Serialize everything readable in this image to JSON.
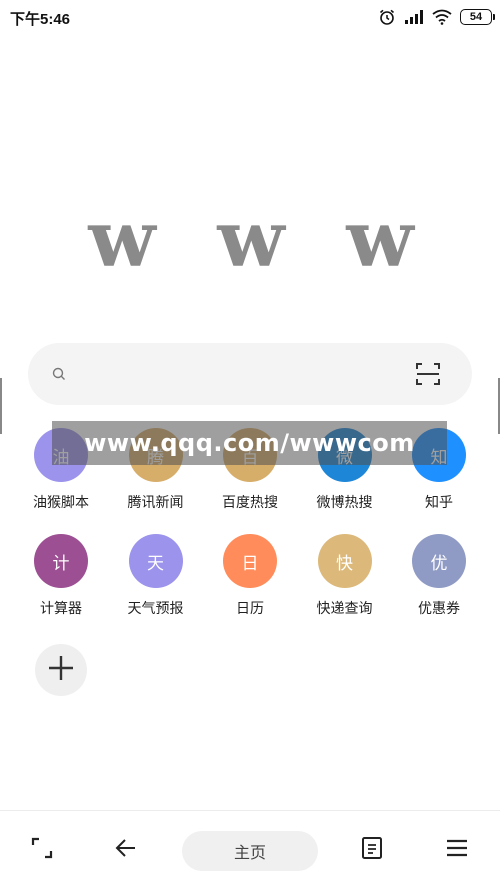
{
  "status_bar": {
    "time": "下午5:46",
    "battery": "54",
    "icons": [
      "alarm-icon",
      "signal-icon",
      "wifi-icon",
      "battery-icon"
    ]
  },
  "logo": {
    "letters": [
      "w",
      "w",
      "w"
    ],
    "color": "#8a8a8a"
  },
  "search": {
    "icon": "search-icon",
    "scan_icon": "scan-icon"
  },
  "shortcuts": [
    {
      "glyph": "油",
      "label": "油猴脚本",
      "color": "#9b93ec"
    },
    {
      "glyph": "腾",
      "label": "腾讯新闻",
      "color": "#d7ad6a"
    },
    {
      "glyph": "百",
      "label": "百度热搜",
      "color": "#d7ad6a"
    },
    {
      "glyph": "微",
      "label": "微博热搜",
      "color": "#1e86d7"
    },
    {
      "glyph": "知",
      "label": "知乎",
      "color": "#1e90ff"
    },
    {
      "glyph": "计",
      "label": "计算器",
      "color": "#9c4f92"
    },
    {
      "glyph": "天",
      "label": "天气预报",
      "color": "#9b93ec"
    },
    {
      "glyph": "日",
      "label": "日历",
      "color": "#ff8c5a"
    },
    {
      "glyph": "快",
      "label": "快递查询",
      "color": "#dcb97a"
    },
    {
      "glyph": "优",
      "label": "优惠券",
      "color": "#8f9bc4"
    }
  ],
  "add_shortcut": {
    "icon": "plus-icon"
  },
  "watermark": {
    "text": "www.qqq.com/wwwcom"
  },
  "bottom_nav": {
    "home_label": "主页",
    "icons": [
      "fullscreen-icon",
      "back-arrow-icon",
      "reader-icon",
      "menu-icon"
    ]
  },
  "colors": {
    "search_bg": "#f4f4f4",
    "nav_home_bg": "#f0f0f0"
  }
}
